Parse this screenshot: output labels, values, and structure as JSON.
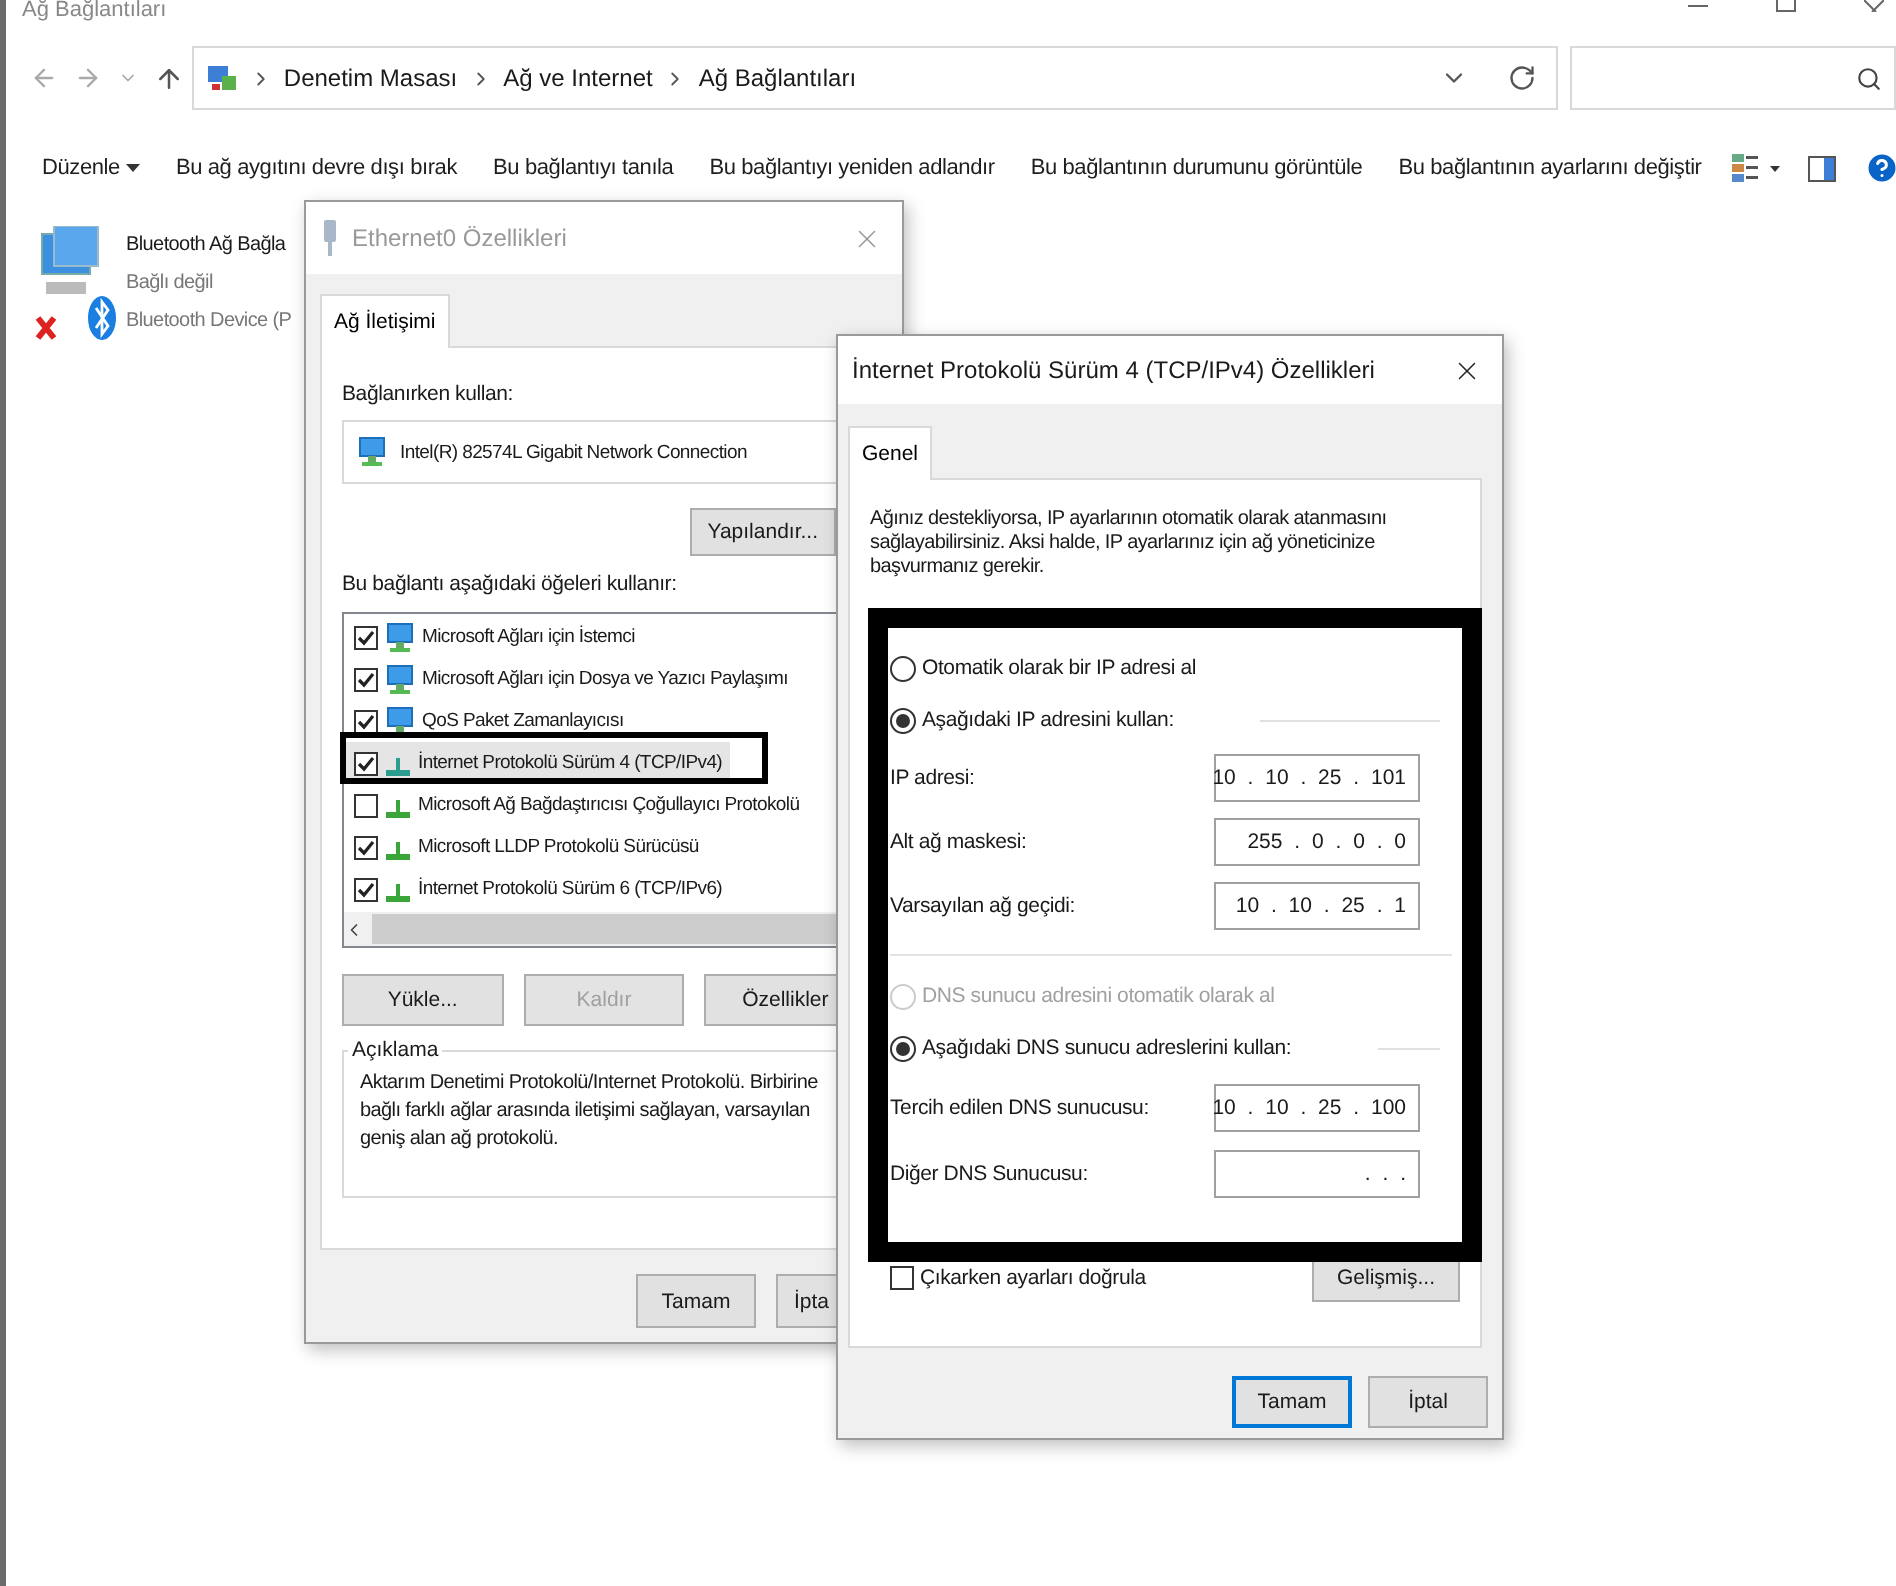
{
  "window": {
    "title": "Ağ Bağlantıları"
  },
  "address_bar": {
    "crumbs": [
      "Denetim Masası",
      "Ağ ve Internet",
      "Ağ Bağlantıları"
    ]
  },
  "toolbar": {
    "items": [
      {
        "label": "Düzenle",
        "kind": "menu"
      },
      {
        "label": "Bu ağ aygıtını devre dışı bırak",
        "kind": "command"
      },
      {
        "label": "Bu bağlantıyı tanıla",
        "kind": "command"
      },
      {
        "label": "Bu bağlantıyı yeniden adlandır",
        "kind": "command"
      },
      {
        "label": "Bu bağlantının durumunu görüntüle",
        "kind": "command"
      },
      {
        "label": "Bu bağlantının ayarlarını değiştir",
        "kind": "command"
      }
    ]
  },
  "connections": [
    {
      "name": "Bluetooth Ağ Bağla",
      "status": "Bağlı değil",
      "device": "Bluetooth Device (P"
    }
  ],
  "ethernet_dialog": {
    "title": "Ethernet0 Özellikleri",
    "tabs": [
      {
        "label": "Ağ İletişimi",
        "selected": true
      }
    ],
    "connect_using_label": "Bağlanırken kullan:",
    "adapter": "Intel(R) 82574L Gigabit Network Connection",
    "configure_button": "Yapılandır...",
    "items_label": "Bu bağlantı aşağıdaki öğeleri kullanır:",
    "items": [
      {
        "label": "Microsoft Ağları için İstemci",
        "kind": "service",
        "checked": true,
        "selected": false
      },
      {
        "label": "Microsoft Ağları için Dosya ve Yazıcı Paylaşımı",
        "kind": "service",
        "checked": true,
        "selected": false
      },
      {
        "label": "QoS Paket Zamanlayıcısı",
        "kind": "service",
        "checked": true,
        "selected": false
      },
      {
        "label": "İnternet Protokolü Sürüm 4 (TCP/IPv4)",
        "kind": "protocol",
        "checked": true,
        "selected": true
      },
      {
        "label": "Microsoft Ağ Bağdaştırıcısı Çoğullayıcı Protokolü",
        "kind": "protocol",
        "checked": false,
        "selected": false
      },
      {
        "label": "Microsoft LLDP Protokolü Sürücüsü",
        "kind": "protocol",
        "checked": true,
        "selected": false
      },
      {
        "label": "İnternet Protokolü Sürüm 6 (TCP/IPv6)",
        "kind": "protocol",
        "checked": true,
        "selected": false
      }
    ],
    "buttons": [
      {
        "label": "Yükle...",
        "disabled": false
      },
      {
        "label": "Kaldır",
        "disabled": true
      },
      {
        "label": "Özellikler",
        "disabled": false
      }
    ],
    "description_title": "Açıklama",
    "description": "Aktarım Denetimi Protokolü/Internet Protokolü. Birbirine bağlı farklı ağlar arasında iletişimi sağlayan, varsayılan geniş alan ağ protokolü.",
    "footer_buttons": [
      "Tamam",
      "İpta"
    ]
  },
  "ipv4_dialog": {
    "title": "İnternet Protokolü Sürüm 4 (TCP/IPv4) Özellikleri",
    "tabs": [
      {
        "label": "Genel",
        "selected": true
      }
    ],
    "intro": "Ağınız destekliyorsa, IP ayarlarının otomatik olarak atanmasını sağlayabilirsiniz. Aksi halde, IP ayarlarınız için ağ yöneticinize başvurmanız gerekir.",
    "ip_options": [
      {
        "label": "Otomatik olarak bir IP adresi al",
        "selected": false,
        "disabled": false
      },
      {
        "label": "Aşağıdaki IP adresini kullan:",
        "selected": true,
        "disabled": false
      }
    ],
    "ip_fields": [
      {
        "label": "IP adresi:",
        "value": "10 . 10 . 25 . 101"
      },
      {
        "label": "Alt ağ maskesi:",
        "value": "255 . 0 . 0 . 0"
      },
      {
        "label": "Varsayılan ağ geçidi:",
        "value": "10 . 10 . 25 . 1"
      }
    ],
    "dns_options": [
      {
        "label": "DNS sunucu adresini otomatik olarak al",
        "selected": false,
        "disabled": true
      },
      {
        "label": "Aşağıdaki DNS sunucu adreslerini kullan:",
        "selected": true,
        "disabled": false
      }
    ],
    "dns_fields": [
      {
        "label": "Tercih edilen DNS sunucusu:",
        "value": "10 . 10 . 25 . 100"
      },
      {
        "label": "Diğer DNS Sunucusu:",
        "value": ". . ."
      }
    ],
    "validate": {
      "label": "Çıkarken ayarları doğrula",
      "checked": false
    },
    "advanced_button": "Gelişmiş...",
    "footer_buttons": [
      {
        "label": "Tamam",
        "default": true
      },
      {
        "label": "İptal",
        "default": false
      }
    ]
  }
}
